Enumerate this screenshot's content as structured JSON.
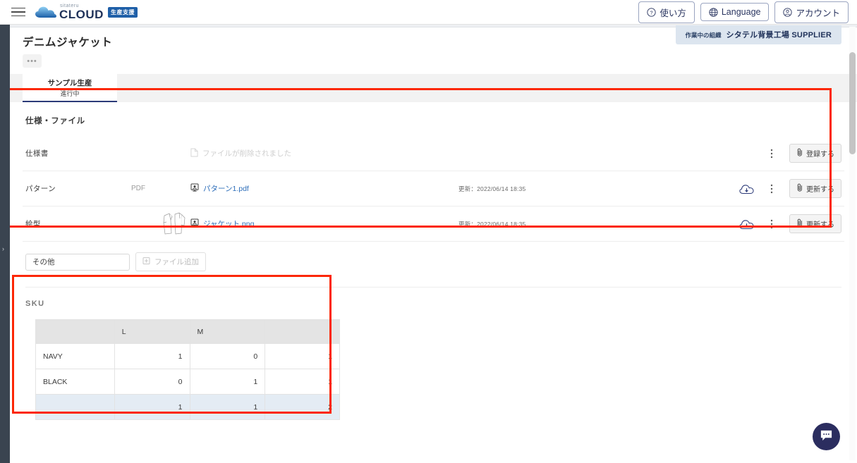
{
  "header": {
    "menu_icon": "hamburger-icon",
    "logo": {
      "brand_small": "sitateru",
      "brand_main": "CLOUD",
      "badge": "生産支援"
    },
    "buttons": [
      {
        "label": "使い方",
        "icon": "question-circle-icon"
      },
      {
        "label": "Language",
        "icon": "globe-icon"
      },
      {
        "label": "アカウント",
        "icon": "account-circle-icon"
      }
    ]
  },
  "org_banner": {
    "label": "作業中の組織",
    "name": "シタテル背景工場 SUPPLIER"
  },
  "page": {
    "title": "デニムジャケット",
    "more_button": "•••",
    "tab": {
      "title": "サンプル生産",
      "sub": "進行中"
    }
  },
  "files_section": {
    "heading": "仕様・ファイル",
    "rows": [
      {
        "label": "仕様書",
        "type": "",
        "empty_text": "ファイルが削除されました",
        "file_name": "",
        "date": "",
        "button": "登録する",
        "has_download": false
      },
      {
        "label": "パターン",
        "type": "PDF",
        "empty_text": "",
        "file_name": "パターン1.pdf",
        "date": "更新：2022/06/14 18:35",
        "button": "更新する",
        "has_download": true
      },
      {
        "label": "絵型",
        "type": "",
        "empty_text": "",
        "file_name": "ジャケット.png",
        "date": "更新：2022/06/14 18:35",
        "button": "更新する",
        "has_download": true
      }
    ],
    "add_row": {
      "select_value": "その他",
      "add_button": "ファイル追加"
    }
  },
  "sku_section": {
    "heading": "SKU",
    "columns": [
      "",
      "L",
      "M",
      ""
    ],
    "rows": [
      {
        "name": "NAVY",
        "values": [
          "1",
          "0",
          "1"
        ]
      },
      {
        "name": "BLACK",
        "values": [
          "0",
          "1",
          "1"
        ]
      }
    ],
    "total": {
      "name": "",
      "values": [
        "1",
        "1",
        "2"
      ]
    }
  },
  "chat_fab": {
    "icon": "chat-bubble-icon"
  },
  "colors": {
    "accent_navy": "#2b3a78",
    "highlight_red": "#fc2703",
    "rail_dark": "#3a4450",
    "link_blue": "#2f6fba",
    "badge_blue": "#1e5fa8",
    "total_row": "#e4ecf4"
  }
}
